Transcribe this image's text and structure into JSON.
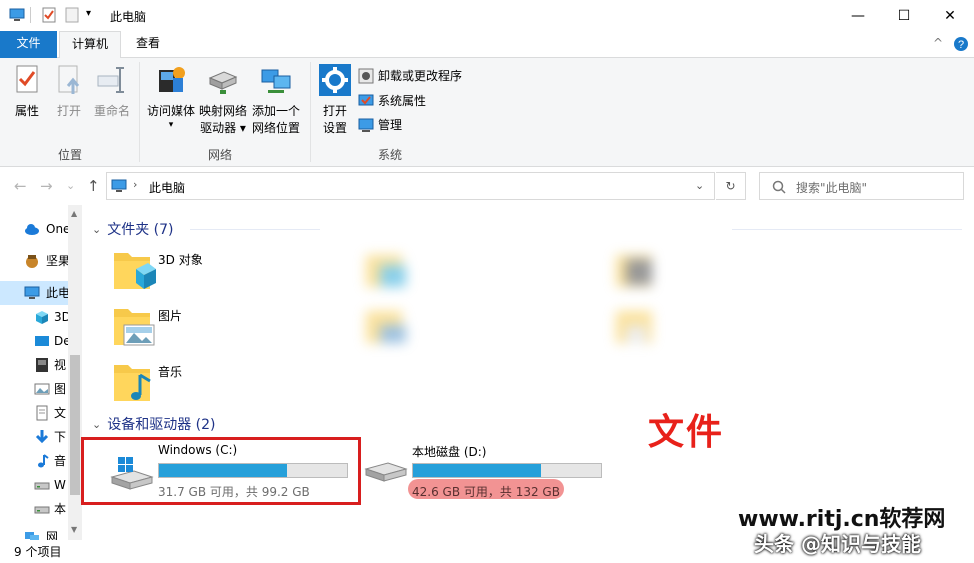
{
  "window": {
    "title": "此电脑",
    "minimize_glyph": "—",
    "maximize_glyph": "☐",
    "close_glyph": "✕"
  },
  "ribbon_tabs": [
    {
      "label": "文件"
    },
    {
      "label": "计算机"
    },
    {
      "label": "查看"
    }
  ],
  "ribbon": {
    "location_group": {
      "label": "位置",
      "buttons": [
        {
          "label": "属性",
          "icon": "properties-icon"
        },
        {
          "label": "打开",
          "icon": "open-icon"
        },
        {
          "label": "重命名",
          "icon": "rename-icon"
        }
      ]
    },
    "network_group": {
      "label": "网络",
      "buttons": [
        {
          "label1": "访问媒体",
          "label2": "▾",
          "icon": "media-icon"
        },
        {
          "label1": "映射网络",
          "label2": "驱动器 ▾",
          "icon": "map-drive-icon"
        },
        {
          "label1": "添加一个",
          "label2": "网络位置",
          "icon": "network-location-icon"
        }
      ]
    },
    "system_group": {
      "label": "系统",
      "open_settings": {
        "label1": "打开",
        "label2": "设置"
      },
      "small_buttons": [
        {
          "label": "卸载或更改程序",
          "icon": "uninstall-icon"
        },
        {
          "label": "系统属性",
          "icon": "system-properties-icon"
        },
        {
          "label": "管理",
          "icon": "manage-icon"
        }
      ]
    }
  },
  "nav": {
    "back": "←",
    "forward": "→",
    "recent": "⌄",
    "up": "↑",
    "breadcrumb": [
      "此电脑"
    ],
    "search_placeholder": "搜索\"此电脑\""
  },
  "sidebar": {
    "items": [
      {
        "label": "One",
        "icon": "onedrive-icon"
      },
      {
        "label": "坚果",
        "icon": "nut-icon"
      },
      {
        "label": "此电",
        "icon": "computer-icon"
      },
      {
        "label": "3D",
        "icon": "3d-objects-icon"
      },
      {
        "label": "De",
        "icon": "desktop-icon"
      },
      {
        "label": "视",
        "icon": "video-icon"
      },
      {
        "label": "图",
        "icon": "pictures-icon"
      },
      {
        "label": "文",
        "icon": "documents-icon"
      },
      {
        "label": "下",
        "icon": "downloads-icon"
      },
      {
        "label": "音",
        "icon": "music-icon"
      },
      {
        "label": "W",
        "icon": "drive-icon"
      },
      {
        "label": "本",
        "icon": "drive-icon"
      },
      {
        "label": "网",
        "icon": "network-icon"
      }
    ]
  },
  "folders": {
    "header": "文件夹 (7)",
    "items": [
      {
        "label": "3D 对象",
        "icon": "3d-folder-icon"
      },
      {
        "label": "图片",
        "icon": "pictures-folder-icon"
      },
      {
        "label": "音乐",
        "icon": "music-folder-icon"
      }
    ]
  },
  "devices": {
    "header": "设备和驱动器 (2)",
    "drives": [
      {
        "name": "Windows (C:)",
        "free": "31.7 GB 可用，共 99.2 GB",
        "used_fraction": 0.68
      },
      {
        "name": "本地磁盘 (D:)",
        "free": "42.6 GB 可用，共 132 GB",
        "used_fraction": 0.68
      }
    ]
  },
  "annotations": {
    "wen_jian": "文件",
    "watermark_url": "www.ritj.cn软荐网",
    "watermark_author": "头条 @知识与技能"
  },
  "status": {
    "item_count": "9 个项目"
  },
  "colors": {
    "accent": "#1979ca",
    "drive_fill": "#26a0da",
    "red_box": "#d81e1e",
    "section_header": "#1e3287"
  }
}
